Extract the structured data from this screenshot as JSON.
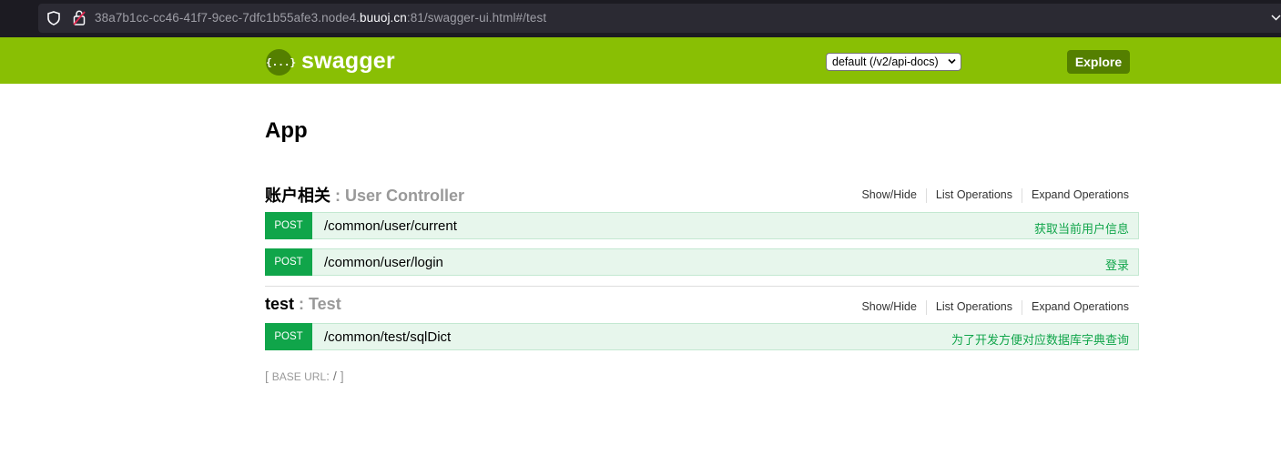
{
  "browser": {
    "url_prefix": "38a7b1cc-cc46-41f7-9cec-7dfc1b55afe3.node4.",
    "url_host": "buuoj.cn",
    "url_suffix": ":81/swagger-ui.html#/test"
  },
  "header": {
    "logo_glyph": "{...}",
    "logo_text": "swagger",
    "spec_select_value": "default (/v2/api-docs)",
    "explore_label": "Explore",
    "brand_color": "#89bf04",
    "button_color": "#547f00"
  },
  "app": {
    "title": "App"
  },
  "resources": [
    {
      "name": "账户相关",
      "separator": " : ",
      "description": "User Controller",
      "links": [
        "Show/Hide",
        "List Operations",
        "Expand Operations"
      ],
      "operations": [
        {
          "method": "POST",
          "path": "/common/user/current",
          "summary": "获取当前用户信息"
        },
        {
          "method": "POST",
          "path": "/common/user/login",
          "summary": "登录"
        }
      ]
    },
    {
      "name": "test",
      "separator": " : ",
      "description": "Test",
      "links": [
        "Show/Hide",
        "List Operations",
        "Expand Operations"
      ],
      "operations": [
        {
          "method": "POST",
          "path": "/common/test/sqlDict",
          "summary": "为了开发方便对应数据库字典查询"
        }
      ]
    }
  ],
  "footer": {
    "open_bracket": "[ ",
    "base_url_label": "BASE URL",
    "colon": ": ",
    "base_url_value": "/",
    "close_bracket": " ]"
  }
}
